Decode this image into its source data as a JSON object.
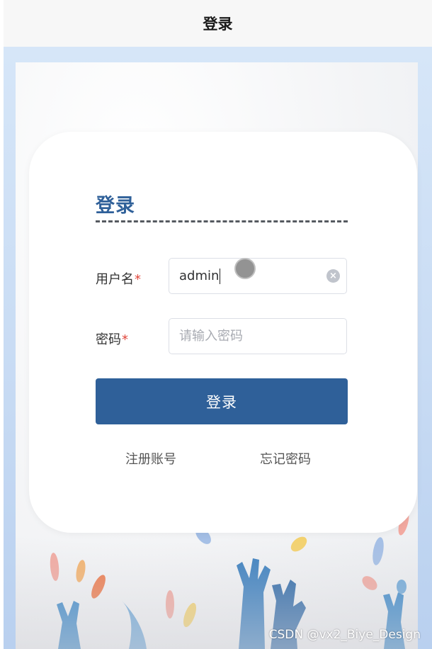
{
  "header": {
    "title": "登录"
  },
  "card": {
    "title": "登录",
    "username": {
      "label": "用户名",
      "required_mark": "*",
      "value": "admin"
    },
    "password": {
      "label": "密码",
      "required_mark": "*",
      "placeholder": "请输入密码"
    },
    "login_label": "登录",
    "register_label": "注册账号",
    "forgot_label": "忘记密码"
  },
  "watermark": "CSDN @vx2_Biye_Design",
  "icons": {
    "clear": "clear-circle-icon"
  },
  "colors": {
    "primary": "#2f6099",
    "required": "#e0453a",
    "background": "#c9dcf4"
  }
}
